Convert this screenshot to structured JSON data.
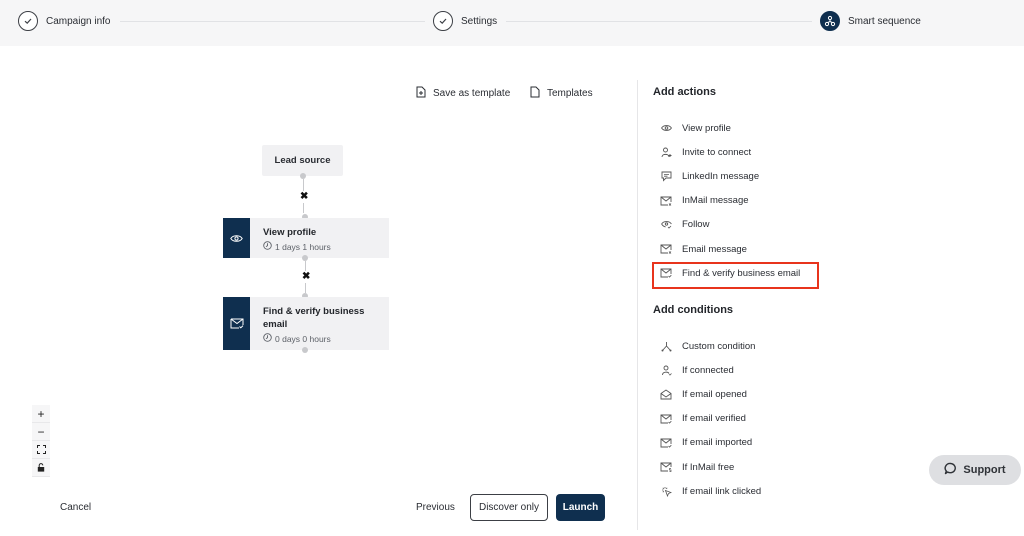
{
  "stepper": {
    "steps": [
      {
        "label": "Campaign info",
        "state": "completed",
        "icon": "check-icon"
      },
      {
        "label": "Settings",
        "state": "completed",
        "icon": "check-icon"
      },
      {
        "label": "Smart sequence",
        "state": "active",
        "icon": "sequence-icon"
      }
    ]
  },
  "toolbar": {
    "save_template": "Save as template",
    "templates": "Templates"
  },
  "flow": {
    "lead_source": "Lead source",
    "nodes": [
      {
        "title": "View profile",
        "duration": "1 days 1 hours",
        "icon": "eye-icon"
      },
      {
        "title": "Find & verify business email",
        "duration": "0 days 0 hours",
        "icon": "mail-check-icon"
      }
    ],
    "remove_symbol": "✖"
  },
  "zoom_controls": {
    "zoom_in": "+",
    "zoom_out": "−"
  },
  "footer": {
    "cancel": "Cancel",
    "previous": "Previous",
    "discover_only": "Discover only",
    "launch": "Launch"
  },
  "panel": {
    "actions_title": "Add actions",
    "actions": [
      {
        "label": "View profile",
        "icon": "eye-icon"
      },
      {
        "label": "Invite to connect",
        "icon": "user-plus-icon"
      },
      {
        "label": "LinkedIn message",
        "icon": "chat-icon"
      },
      {
        "label": "InMail message",
        "icon": "inmail-icon"
      },
      {
        "label": "Follow",
        "icon": "follow-icon"
      },
      {
        "label": "Email message",
        "icon": "mail-icon"
      },
      {
        "label": "Find & verify business email",
        "icon": "mail-check-icon",
        "highlighted": true
      }
    ],
    "conditions_title": "Add conditions",
    "conditions": [
      {
        "label": "Custom condition",
        "icon": "branch-icon"
      },
      {
        "label": "If connected",
        "icon": "user-icon"
      },
      {
        "label": "If email opened",
        "icon": "mail-open-icon"
      },
      {
        "label": "If email verified",
        "icon": "mail-check-icon"
      },
      {
        "label": "If email imported",
        "icon": "mail-import-icon"
      },
      {
        "label": "If InMail free",
        "icon": "inmail-free-icon"
      },
      {
        "label": "If email link clicked",
        "icon": "click-icon"
      }
    ]
  },
  "support": {
    "label": "Support"
  },
  "colors": {
    "brand": "#0f2f4f",
    "highlight": "#e8341c"
  }
}
